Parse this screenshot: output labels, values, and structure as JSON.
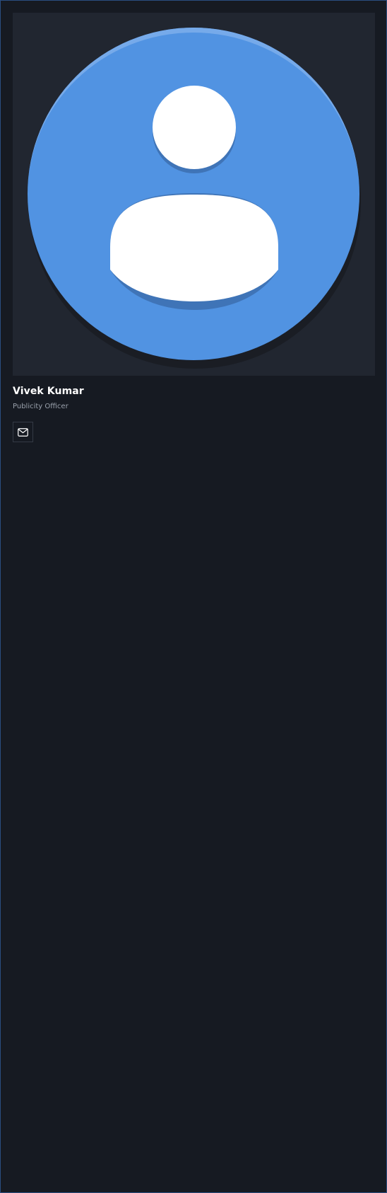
{
  "profile": {
    "name": "Vivek Kumar",
    "title": "Publicity Officer"
  },
  "actions": {
    "email_icon": "mail-icon"
  },
  "avatar": {
    "icon": "default-user-avatar-icon",
    "circle_color": "#5193e2",
    "figure_color": "#ffffff",
    "frame_color": "#212630"
  },
  "colors": {
    "background": "#161a22",
    "border": "#2a4e80",
    "name_text": "#ffffff",
    "role_text": "#9aa1ac"
  }
}
